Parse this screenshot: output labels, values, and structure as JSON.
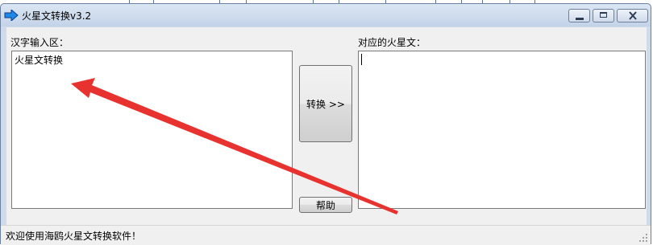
{
  "window": {
    "title": "火星文转换v3.2",
    "icon": "arrow-right-icon"
  },
  "caption_buttons": [
    "minimize",
    "maximize",
    "close"
  ],
  "input_panel": {
    "label": "汉字输入区：",
    "value": "火星文转换"
  },
  "output_panel": {
    "label": "对应的火星文：",
    "value": ""
  },
  "buttons": {
    "convert_label": "转换 >>",
    "help_label": "帮助"
  },
  "status_bar": {
    "text": "欢迎使用海鸥火星文转换软件！"
  },
  "annotation": {
    "type": "arrow",
    "color": "#e8322f"
  }
}
